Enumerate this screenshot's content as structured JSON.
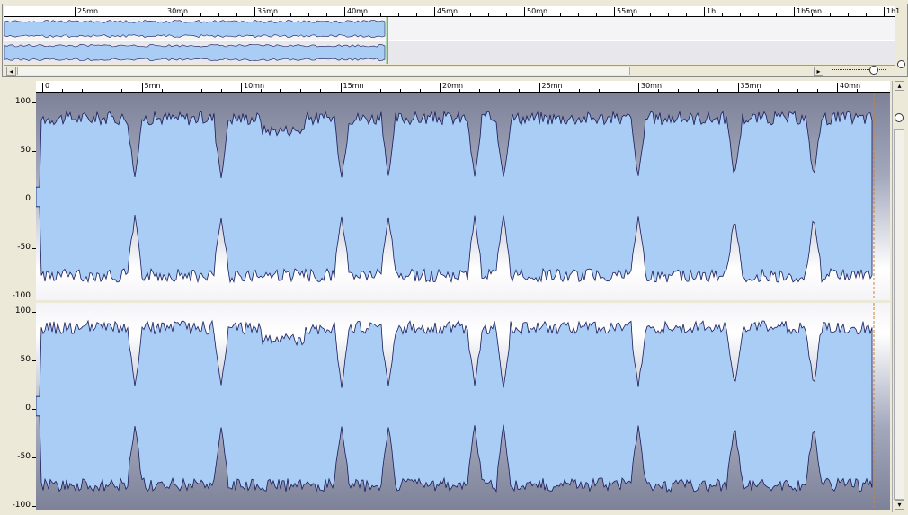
{
  "overview": {
    "ruler_labels": [
      "25mn",
      "30mn",
      "35mn",
      "40mn",
      "45mn",
      "50mn",
      "55mn",
      "1h",
      "1h5mn",
      "1h1"
    ],
    "played_fraction": 0.43,
    "scroll_left_icon": "triangle-left",
    "scroll_right_icon": "triangle-right"
  },
  "main": {
    "ruler_labels": [
      "0",
      "5mn",
      "10mn",
      "15mn",
      "20mn",
      "25mn",
      "30mn",
      "35mn",
      "40mn"
    ],
    "channels": [
      {
        "name": "left",
        "y_ticks": [
          "100",
          "50",
          "0",
          "-50",
          "-100"
        ]
      },
      {
        "name": "right",
        "y_ticks": [
          "100",
          "50",
          "0",
          "-50",
          "-100"
        ]
      }
    ],
    "waveform_color": "#a9cdf5",
    "waveform_outline": "#1a1a5a",
    "background_color": "#9aa0b8",
    "cursor_color": "#d08030"
  }
}
